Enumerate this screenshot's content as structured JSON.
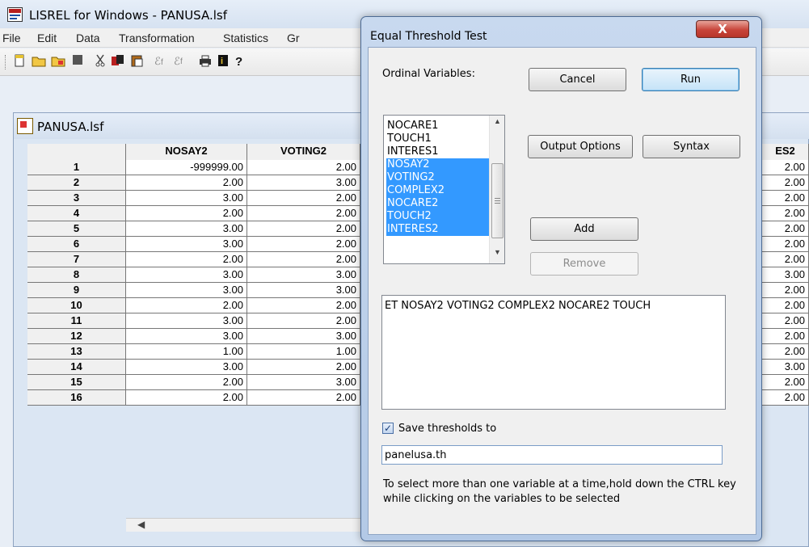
{
  "app": {
    "title": "LISREL for Windows - PANUSA.lsf",
    "menu": [
      "File",
      "Edit",
      "Data",
      "Transformation",
      "Statistics",
      "Gr"
    ],
    "toolbar_icons": [
      "new-file-icon",
      "open-file-icon",
      "open-file-alt-icon",
      "stop-icon",
      "cut-icon",
      "copy-icon",
      "paste-icon",
      "path-icon",
      "path-alt-icon",
      "print-icon",
      "info-icon",
      "help-icon"
    ]
  },
  "sheet": {
    "title": "PANUSA.lsf",
    "columns": [
      "NOSAY2",
      "VOTING2"
    ],
    "right_column_partial": "ES2",
    "rows": [
      {
        "n": "1",
        "nosay2": "-999999.00",
        "voting2": "2.00",
        "right": "2.00"
      },
      {
        "n": "2",
        "nosay2": "2.00",
        "voting2": "3.00",
        "right": "2.00"
      },
      {
        "n": "3",
        "nosay2": "3.00",
        "voting2": "2.00",
        "right": "2.00"
      },
      {
        "n": "4",
        "nosay2": "2.00",
        "voting2": "2.00",
        "right": "2.00"
      },
      {
        "n": "5",
        "nosay2": "3.00",
        "voting2": "2.00",
        "right": "2.00"
      },
      {
        "n": "6",
        "nosay2": "3.00",
        "voting2": "2.00",
        "right": "2.00"
      },
      {
        "n": "7",
        "nosay2": "2.00",
        "voting2": "2.00",
        "right": "2.00"
      },
      {
        "n": "8",
        "nosay2": "3.00",
        "voting2": "3.00",
        "right": "3.00"
      },
      {
        "n": "9",
        "nosay2": "3.00",
        "voting2": "3.00",
        "right": "2.00"
      },
      {
        "n": "10",
        "nosay2": "2.00",
        "voting2": "2.00",
        "right": "2.00"
      },
      {
        "n": "11",
        "nosay2": "3.00",
        "voting2": "2.00",
        "right": "2.00"
      },
      {
        "n": "12",
        "nosay2": "3.00",
        "voting2": "3.00",
        "right": "2.00"
      },
      {
        "n": "13",
        "nosay2": "1.00",
        "voting2": "1.00",
        "right": "2.00"
      },
      {
        "n": "14",
        "nosay2": "3.00",
        "voting2": "2.00",
        "right": "3.00"
      },
      {
        "n": "15",
        "nosay2": "2.00",
        "voting2": "3.00",
        "right": "2.00"
      },
      {
        "n": "16",
        "nosay2": "2.00",
        "voting2": "2.00",
        "right": "2.00"
      }
    ]
  },
  "dialog": {
    "title": "Equal Threshold Test",
    "close_label": "X",
    "ordinal_label": "Ordinal Variables:",
    "variables": [
      {
        "name": "NOCARE1",
        "selected": false
      },
      {
        "name": "TOUCH1",
        "selected": false
      },
      {
        "name": "INTERES1",
        "selected": false
      },
      {
        "name": "NOSAY2",
        "selected": true
      },
      {
        "name": "VOTING2",
        "selected": true
      },
      {
        "name": "COMPLEX2",
        "selected": true
      },
      {
        "name": "NOCARE2",
        "selected": true
      },
      {
        "name": "TOUCH2",
        "selected": true
      },
      {
        "name": "INTERES2",
        "selected": true
      }
    ],
    "buttons": {
      "cancel": "Cancel",
      "run": "Run",
      "output_options": "Output Options",
      "syntax": "Syntax",
      "add": "Add",
      "remove": "Remove"
    },
    "syntax_text": "ET  NOSAY2 VOTING2 COMPLEX2 NOCARE2 TOUCH",
    "save_checkbox_label": "Save thresholds to",
    "save_checked": true,
    "save_filename": "panelusa.th",
    "hint": "To select more than one variable at a time,hold down the CTRL key while clicking on the variables to be selected"
  }
}
